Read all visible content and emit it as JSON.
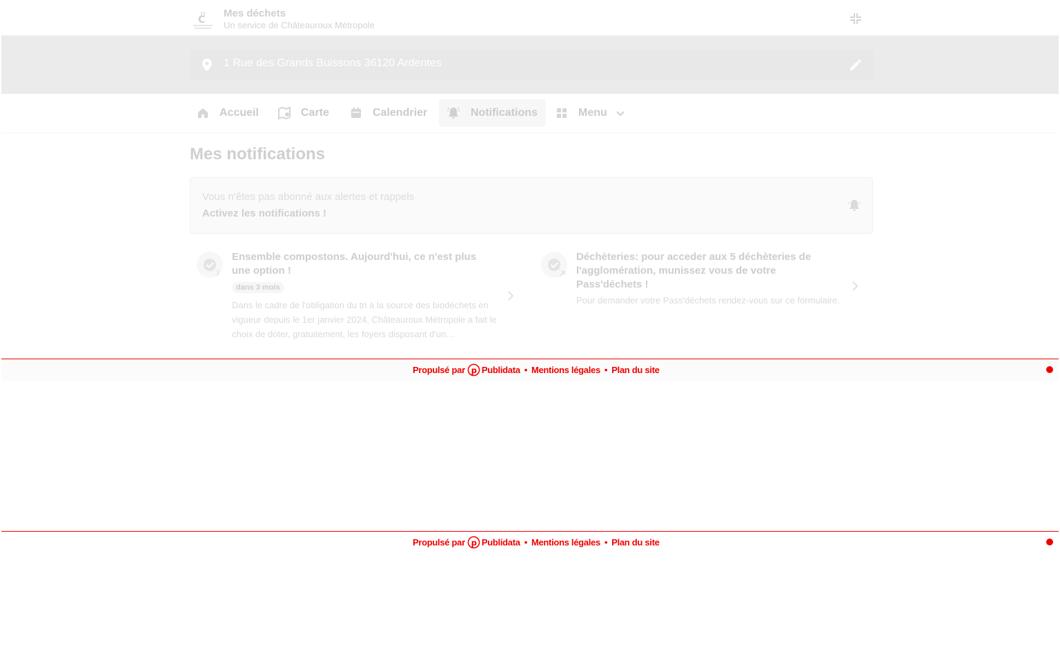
{
  "header": {
    "title": "Mes déchets",
    "subtitle": "Un service de Châteauroux Métropole"
  },
  "address": {
    "text": "1 Rue des Grands Buissons 36120 Ardentes"
  },
  "nav": {
    "items": [
      {
        "label": "Accueil",
        "icon": "home-icon"
      },
      {
        "label": "Carte",
        "icon": "map-icon"
      },
      {
        "label": "Calendrier",
        "icon": "calendar-icon"
      },
      {
        "label": "Notifications",
        "icon": "bell-icon",
        "active": true
      },
      {
        "label": "Menu",
        "icon": "grid-icon"
      }
    ]
  },
  "main": {
    "title": "Mes notifications",
    "alert": {
      "line1": "Vous n'êtes pas abonné aux alertes et rappels",
      "line2": "Activez les notifications !"
    },
    "notifications": [
      {
        "title": "Ensemble compostons. Aujourd'hui, ce n'est plus une option !",
        "badge": "dans 3 mois",
        "body": "Dans le cadre de l'obligation du tri à la source des biodéchets en vigueur depuis le 1er janvier 2024, Châteauroux Métropole a fait le choix de doter, gratuitement, les foyers disposant d'un…"
      },
      {
        "title": "Déchèteries: pour acceder aux 5 déchèteries de l'agglomération, munissez vous de votre Pass'déchets !",
        "body": "Pour demander votre Pass'déchets rendez-vous sur ce formulaire."
      }
    ]
  },
  "footer": {
    "powered": "Propulsé par",
    "brand": "Publidata",
    "legal": "Mentions légales",
    "sitemap": "Plan du site",
    "separator": "•",
    "accent": "#f00000"
  }
}
